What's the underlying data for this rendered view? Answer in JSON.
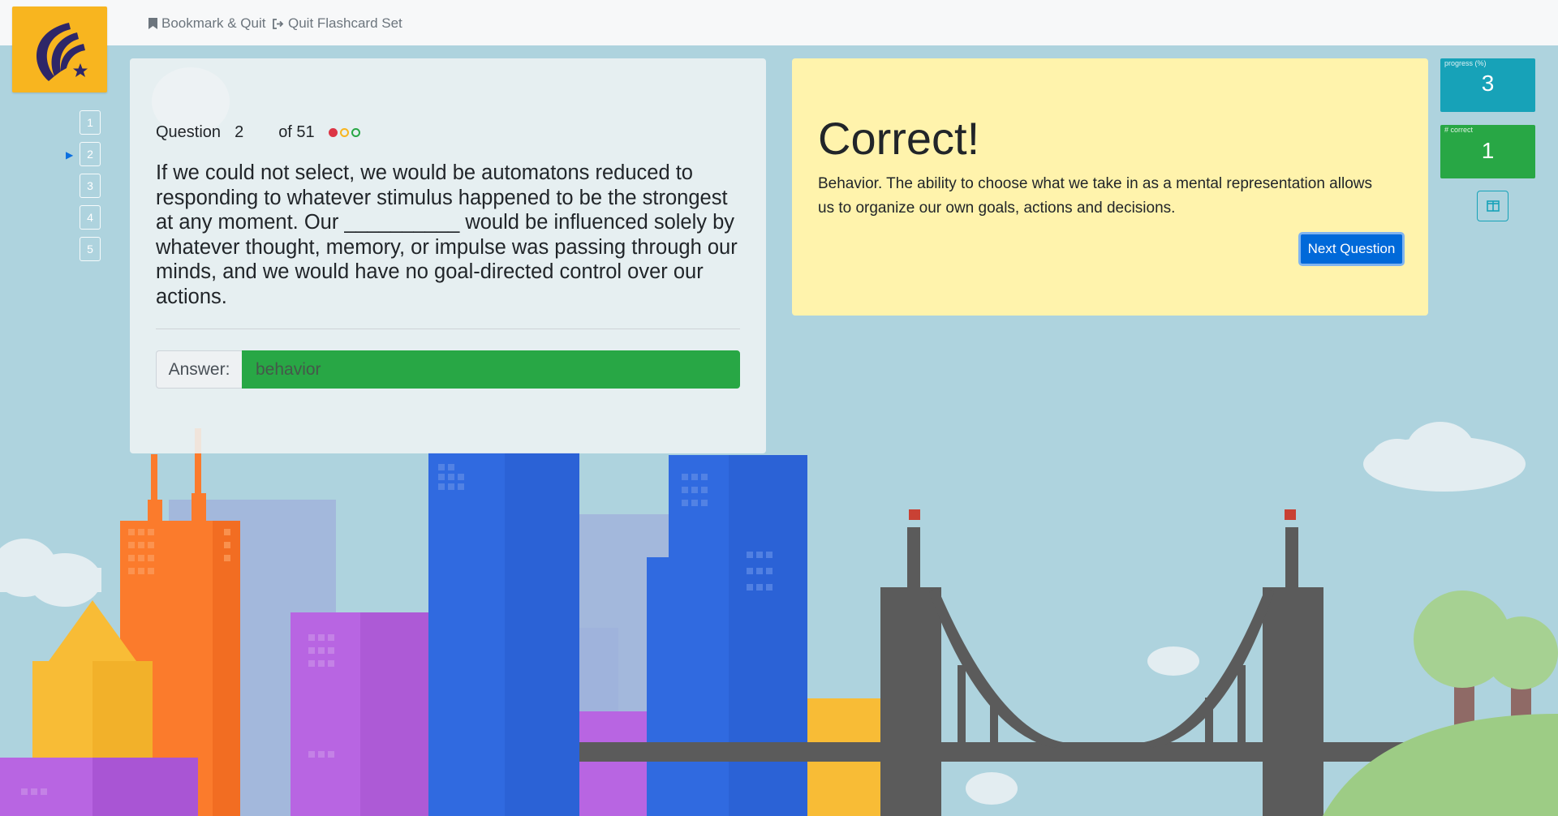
{
  "topbar": {
    "bookmark_label": "Bookmark & Quit",
    "quit_label": "Quit Flashcard Set"
  },
  "question_nav": {
    "items": [
      "1",
      "2",
      "3",
      "4",
      "5"
    ],
    "current": "2"
  },
  "question": {
    "label": "Question",
    "number": "2",
    "total": "of 51",
    "status_dot_colors": [
      "#dc3545",
      "#f8b51f",
      "#28a745"
    ],
    "text": "If we could not select, we would be automatons reduced to responding to whatever stimulus happened to be the strongest at any moment. Our __________ would be influenced solely by whatever thought, memory, or impulse was passing through our minds, and we would have no goal-directed control over our actions.",
    "answer_label": "Answer:",
    "answer_value": "behavior"
  },
  "result": {
    "title": "Correct!",
    "explanation": "Behavior. The ability to choose what we take in as a mental representation allows us to organize our own goals, actions and decisions.",
    "next_button": "Next Question"
  },
  "stats": {
    "progress_label": "progress (%)",
    "progress_value": "3",
    "correct_label": "# correct",
    "correct_value": "1"
  },
  "colors": {
    "accent": "#0069d9",
    "correct": "#28a745",
    "progress": "#17a2b8",
    "result_bg": "#fff3ac",
    "logo_bg": "#f8b51f"
  },
  "icons": {
    "bookmark": "bookmark-icon",
    "quit": "sign-out-icon",
    "toggle": "columns-icon"
  }
}
